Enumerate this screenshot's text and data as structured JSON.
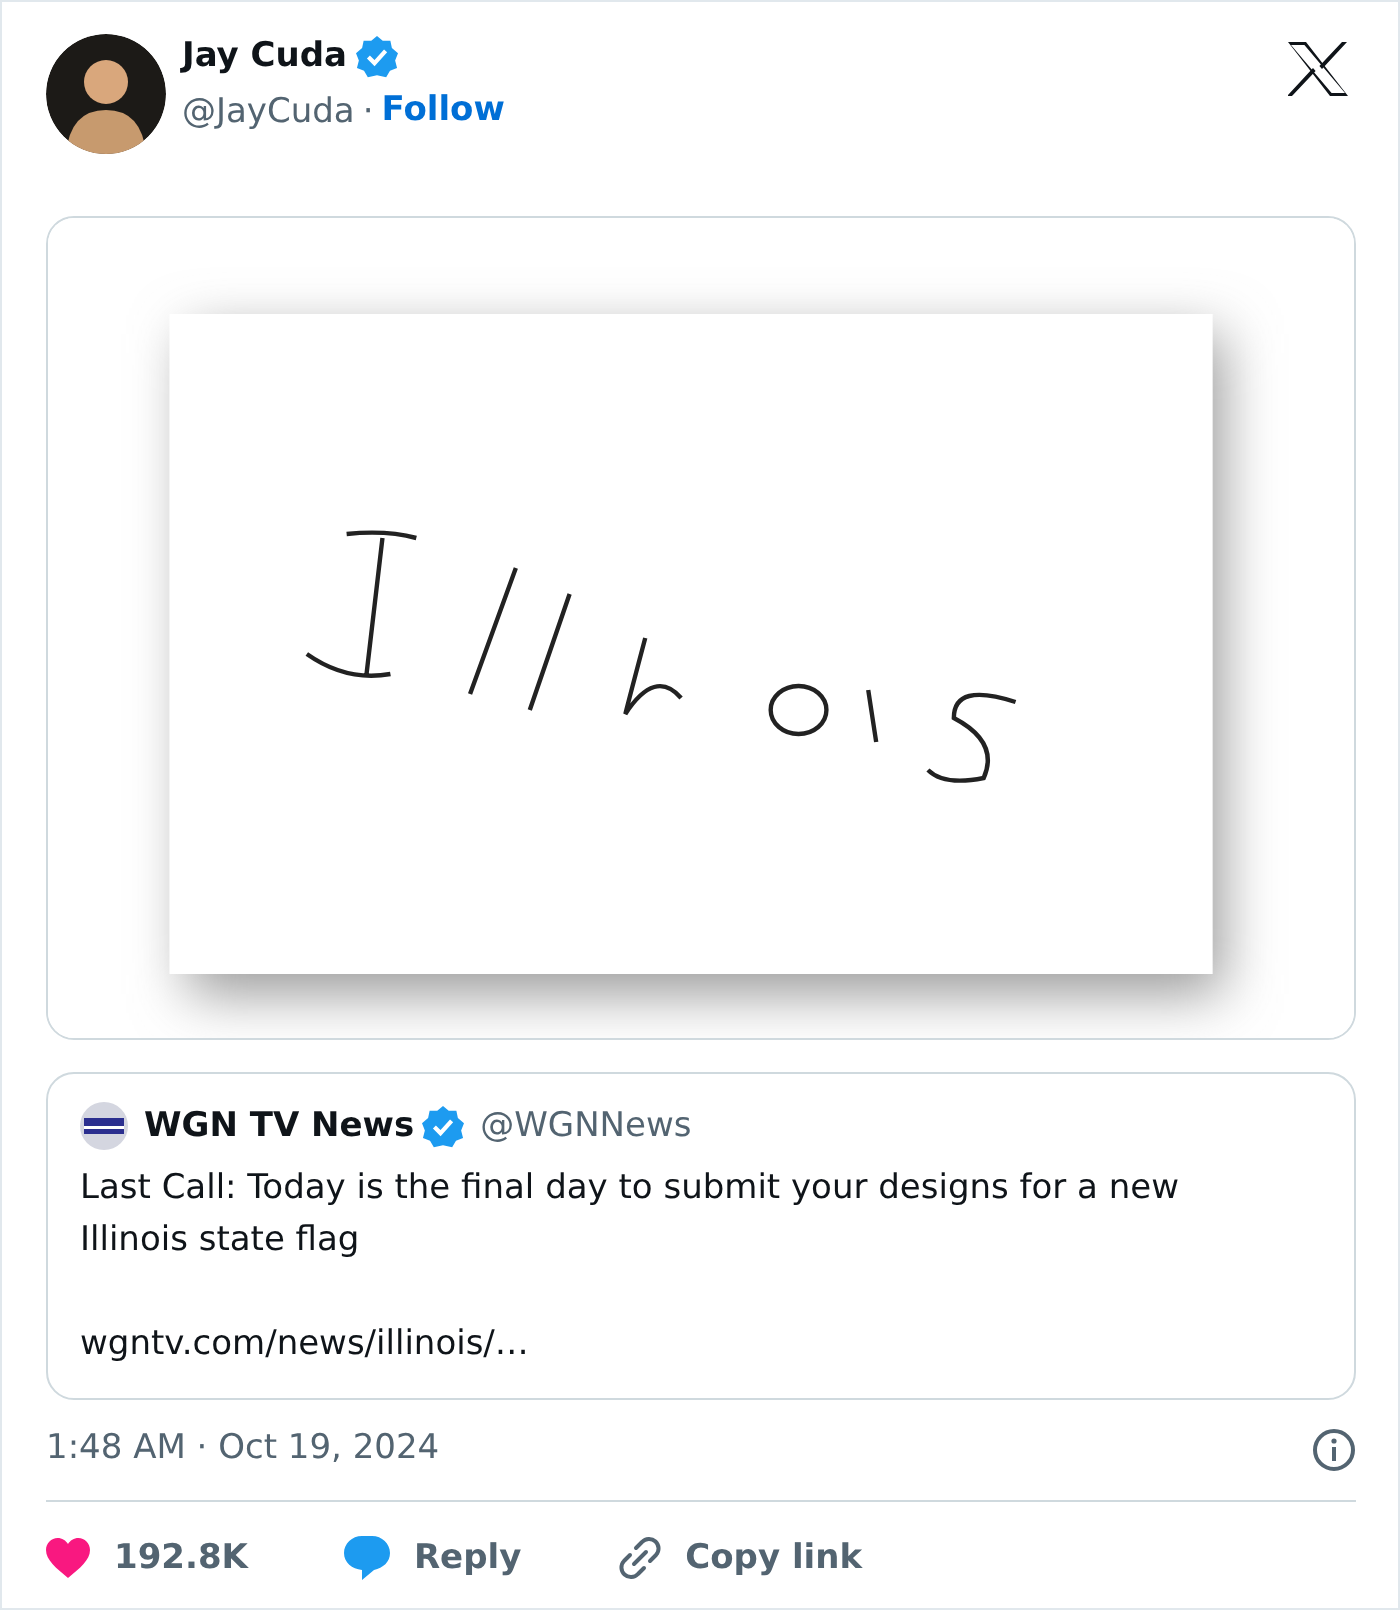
{
  "author": {
    "name": "Jay Cuda",
    "verified": true,
    "handle": "@JayCuda",
    "separator": "·",
    "follow": "Follow"
  },
  "quoted_tweet": {
    "name": "WGN TV News",
    "verified": true,
    "handle": "@WGNNews",
    "text": "Last Call: Today is the final day to submit your designs for a new Illinois state flag",
    "link": "wgntv.com/news/illinois/…"
  },
  "timestamp": "1:48 AM · Oct 19, 2024",
  "actions": [
    {
      "kind": "like",
      "label": "192.8K"
    },
    {
      "kind": "reply",
      "label": "Reply"
    },
    {
      "kind": "copy",
      "label": "Copy link"
    }
  ]
}
